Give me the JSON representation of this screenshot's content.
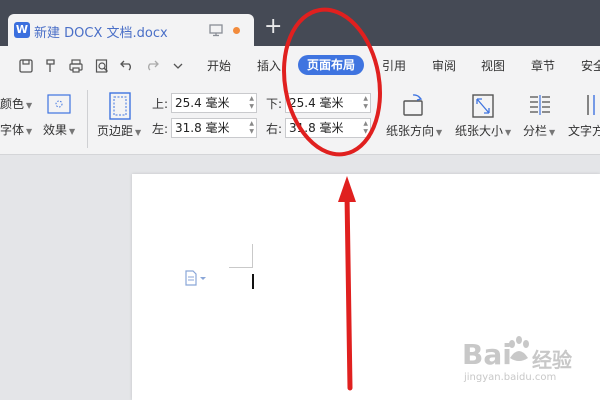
{
  "titlebar": {
    "doc_icon": "W",
    "doc_name": "新建 DOCX 文档.docx",
    "new_tab": "+"
  },
  "menu": {
    "items": [
      "开始",
      "插入",
      "页面布局",
      "引用",
      "审阅",
      "视图",
      "章节",
      "安全"
    ],
    "active": "页面布局"
  },
  "ribbon": {
    "color_label": "颜色",
    "font_label": "字体",
    "effect_label": "效果",
    "margin_label": "页边距",
    "top_label": "上:",
    "top_value": "25.4 毫米",
    "left_label": "左:",
    "left_value": "31.8 毫米",
    "bottom_label": "下:",
    "bottom_value": "25.4 毫米",
    "right_label": "右:",
    "right_value": "31.8 毫米",
    "orientation_label": "纸张方向",
    "size_label": "纸张大小",
    "columns_label": "分栏",
    "text_dir_label": "文字方"
  },
  "watermark": {
    "brand": "Bai",
    "brand_suffix": "经验",
    "url": "jingyan.baidu.com"
  },
  "colors": {
    "accent": "#3f74e0",
    "annotation": "#e0201f",
    "titlebar": "#454a55"
  }
}
